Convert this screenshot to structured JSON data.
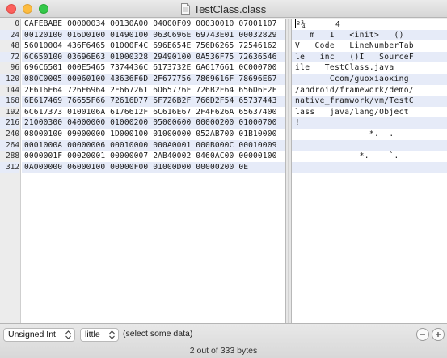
{
  "window": {
    "title": "TestClass.class",
    "title_icon": "class-file-icon"
  },
  "gutter": {
    "offsets": [
      "0",
      "24",
      "48",
      "72",
      "96",
      "120",
      "144",
      "168",
      "192",
      "216",
      "240",
      "264",
      "288",
      "312"
    ]
  },
  "hex": {
    "rows": [
      "CAFEBABE 00000034 00130A00 04000F09 00030010 07001107",
      "00120100 016D0100 01490100 063C696E 69743E01 00032829",
      "56010004 436F6465 01000F4C 696E654E 756D6265 72546162",
      "6C650100 03696E63 01000328 29490100 0A536F75 72636546",
      "696C6501 000E5465 7374436C 6173732E 6A617661 0C000700",
      "080C0005 00060100 43636F6D 2F677756 7869616F 78696E67",
      "2F616E64 726F6964 2F667261 6D65776F 726B2F64 656D6F2F",
      "6E617469 76655F66 72616D77 6F726B2F 766D2F54 65737443",
      "6C617373 0100106A 6176612F 6C616E67 2F4F626A 65637400",
      "21000300 04000000 01000200 05000600 00000200 01000700",
      "08000100 09000000 1D000100 01000000 052AB700 01B10000",
      "0001000A 00000006 00010000 000A0001 000B000C 00010009",
      "0000001F 00020001 00000007 2AB40002 0460AC00 00000100",
      "0A000000 06000100 00000F00 01000D00 00000200 0E"
    ]
  },
  "ascii": {
    "rows": [
      "º¾      4",
      "   m   I   <init>   ()",
      "V   Code   LineNumberTab",
      "le   inc   ()I   SourceF",
      "ile   TestClass.java",
      "       Ccom/guoxiaoxing",
      "/android/framework/demo/",
      "native_framwork/vm/TestC",
      "lass   java/lang/Object",
      "!",
      "               *.  .",
      "",
      "             *.    `.",
      ""
    ]
  },
  "footer": {
    "type_select": "Unsigned Int",
    "endian_select": "little",
    "hint": "(select some data)",
    "minus_label": "−",
    "plus_label": "+",
    "status": "2 out of 333 bytes"
  }
}
